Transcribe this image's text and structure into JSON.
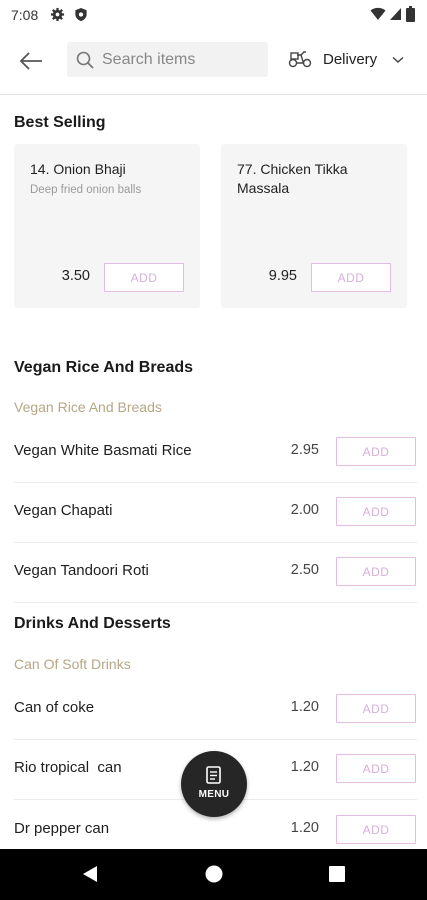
{
  "status_bar": {
    "time": "7:08",
    "left_icons": [
      "gear-icon",
      "shield-icon"
    ],
    "right_icons": [
      "wifi-icon",
      "signal-icon",
      "battery-icon"
    ]
  },
  "topbar": {
    "back_icon": "arrow-left-icon",
    "search": {
      "placeholder": "Search items",
      "value": ""
    },
    "delivery": {
      "label": "Delivery",
      "icon": "scooter-icon"
    }
  },
  "best_selling": {
    "title": "Best Selling",
    "items": [
      {
        "name": "14. Onion Bhaji",
        "description": "Deep fried onion balls",
        "price": "3.50",
        "add_label": "ADD"
      },
      {
        "name": "77. Chicken Tikka Massala",
        "description": "",
        "price": "9.95",
        "add_label": "ADD"
      }
    ]
  },
  "sections": [
    {
      "title": "Vegan Rice And Breads",
      "category": "Vegan Rice And Breads",
      "items": [
        {
          "name": "Vegan White Basmati Rice",
          "price": "2.95",
          "add_label": "ADD"
        },
        {
          "name": "Vegan Chapati",
          "price": "2.00",
          "add_label": "ADD"
        },
        {
          "name": "Vegan Tandoori Roti",
          "price": "2.50",
          "add_label": "ADD"
        }
      ]
    },
    {
      "title": "Drinks And Desserts",
      "category": "Can Of Soft Drinks",
      "items": [
        {
          "name": "Can of coke",
          "price": "1.20",
          "add_label": "ADD"
        },
        {
          "name": "Rio tropical  can",
          "price": "1.20",
          "add_label": "ADD"
        },
        {
          "name": "Dr pepper can",
          "price": "1.20",
          "add_label": "ADD"
        }
      ]
    }
  ],
  "menu_fab": {
    "label": "MENU",
    "icon": "menu-document-icon"
  },
  "colors": {
    "accent_border": "#e2bce2",
    "accent_text": "#d7b0d9",
    "category_text": "#b8a684",
    "fab_bg": "#262626"
  },
  "navbar": {
    "buttons": [
      "back-triangle-icon",
      "home-circle-icon",
      "recents-square-icon"
    ]
  }
}
